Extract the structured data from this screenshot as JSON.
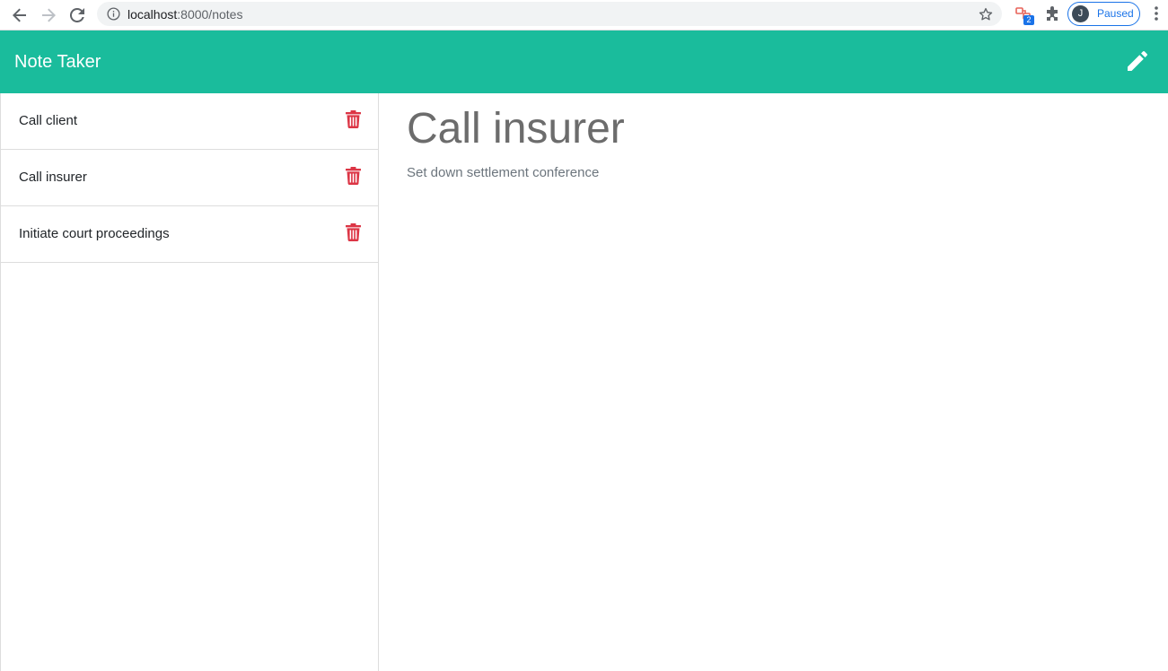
{
  "browser": {
    "url_host": "localhost",
    "url_path": ":8000/notes",
    "extension_badge": "2",
    "profile_initial": "J",
    "profile_status": "Paused"
  },
  "header": {
    "title": "Note Taker",
    "new_note_icon": "pencil-icon"
  },
  "notes": [
    {
      "title": "Call client",
      "delete_icon": "trash-icon"
    },
    {
      "title": "Call insurer",
      "delete_icon": "trash-icon"
    },
    {
      "title": "Initiate court proceedings",
      "delete_icon": "trash-icon"
    }
  ],
  "active_note": {
    "title": "Call insurer",
    "text": "Set down settlement conference"
  },
  "colors": {
    "header_bg": "#1abc9c",
    "delete_icon": "#dc3545",
    "heading_text": "#6c6c6c"
  }
}
